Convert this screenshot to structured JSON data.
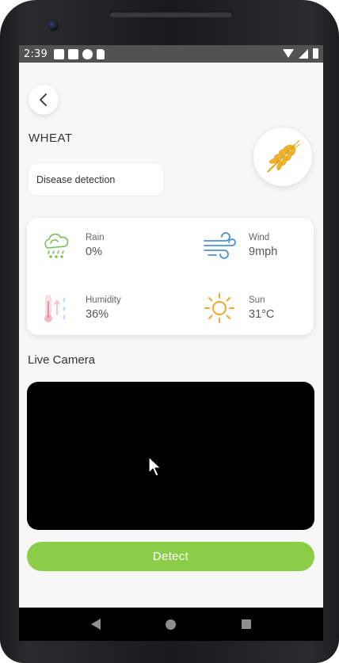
{
  "status_bar": {
    "time": "2:39",
    "left_icons": [
      "notification-icon",
      "notification-icon",
      "google-icon",
      "sd-card-icon"
    ],
    "right_icons": [
      "wifi-icon",
      "cell-signal-icon",
      "battery-icon"
    ]
  },
  "header": {
    "back_icon": "chevron-left-icon",
    "crop_name": "WHEAT",
    "crop_icon": "wheat-icon"
  },
  "disease_button": {
    "label": "Disease detection"
  },
  "weather": {
    "items": [
      {
        "label": "Rain",
        "value": "0%",
        "icon": "rain-cloud-icon"
      },
      {
        "label": "Wind",
        "value": "9mph",
        "icon": "wind-icon"
      },
      {
        "label": "Humidity",
        "value": "36%",
        "icon": "humidity-icon"
      },
      {
        "label": "Sun",
        "value": "31°C",
        "icon": "sun-icon"
      }
    ]
  },
  "camera": {
    "title": "Live Camera"
  },
  "detect_button": {
    "label": "Detect"
  },
  "colors": {
    "accent": "#8ccd47",
    "wheat": "#f0b429",
    "sun": "#f2a533",
    "wind": "#4a90d9",
    "rain": "#7fbf5a"
  },
  "nav_bar": {
    "icons": [
      "back-triangle-icon",
      "home-circle-icon",
      "recents-square-icon"
    ]
  }
}
